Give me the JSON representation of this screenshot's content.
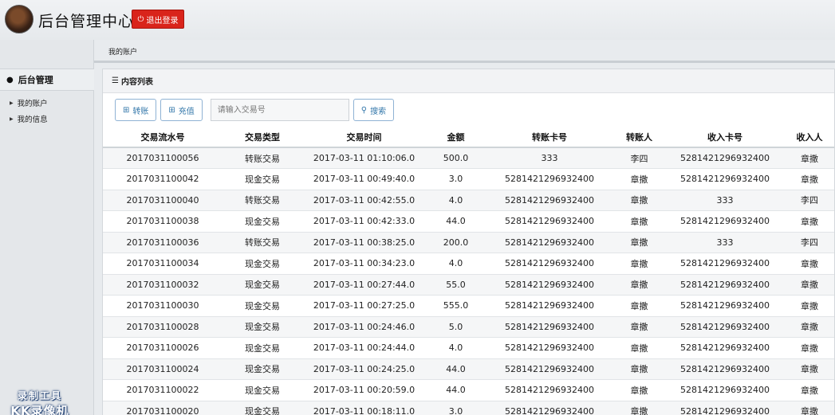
{
  "header": {
    "title": "后台管理中心",
    "logout_label": "退出登录",
    "logout_color": "#d9241b"
  },
  "breadcrumb": "我的账户",
  "sidebar": {
    "section_title": "后台管理",
    "items": [
      {
        "label": "我的账户"
      },
      {
        "label": "我的信息"
      }
    ],
    "watermark_line1": "录制工具",
    "watermark_line2": "KK录像机"
  },
  "panel": {
    "title": "内容列表",
    "transfer_label": "转账",
    "recharge_label": "充值",
    "search_placeholder": "请输入交易号",
    "search_label": "搜索"
  },
  "table": {
    "columns": [
      "交易流水号",
      "交易类型",
      "交易时间",
      "金额",
      "转账卡号",
      "转账人",
      "收入卡号",
      "收入人"
    ],
    "rows": [
      [
        "2017031100056",
        "转账交易",
        "2017-03-11 01:10:06.0",
        "500.0",
        "333",
        "李四",
        "5281421296932400",
        "章撒"
      ],
      [
        "2017031100042",
        "现金交易",
        "2017-03-11 00:49:40.0",
        "3.0",
        "5281421296932400",
        "章撒",
        "5281421296932400",
        "章撒"
      ],
      [
        "2017031100040",
        "转账交易",
        "2017-03-11 00:42:55.0",
        "4.0",
        "5281421296932400",
        "章撒",
        "333",
        "李四"
      ],
      [
        "2017031100038",
        "现金交易",
        "2017-03-11 00:42:33.0",
        "44.0",
        "5281421296932400",
        "章撒",
        "5281421296932400",
        "章撒"
      ],
      [
        "2017031100036",
        "转账交易",
        "2017-03-11 00:38:25.0",
        "200.0",
        "5281421296932400",
        "章撒",
        "333",
        "李四"
      ],
      [
        "2017031100034",
        "现金交易",
        "2017-03-11 00:34:23.0",
        "4.0",
        "5281421296932400",
        "章撒",
        "5281421296932400",
        "章撒"
      ],
      [
        "2017031100032",
        "现金交易",
        "2017-03-11 00:27:44.0",
        "55.0",
        "5281421296932400",
        "章撒",
        "5281421296932400",
        "章撒"
      ],
      [
        "2017031100030",
        "现金交易",
        "2017-03-11 00:27:25.0",
        "555.0",
        "5281421296932400",
        "章撒",
        "5281421296932400",
        "章撒"
      ],
      [
        "2017031100028",
        "现金交易",
        "2017-03-11 00:24:46.0",
        "5.0",
        "5281421296932400",
        "章撒",
        "5281421296932400",
        "章撒"
      ],
      [
        "2017031100026",
        "现金交易",
        "2017-03-11 00:24:44.0",
        "4.0",
        "5281421296932400",
        "章撒",
        "5281421296932400",
        "章撒"
      ],
      [
        "2017031100024",
        "现金交易",
        "2017-03-11 00:24:25.0",
        "44.0",
        "5281421296932400",
        "章撒",
        "5281421296932400",
        "章撒"
      ],
      [
        "2017031100022",
        "现金交易",
        "2017-03-11 00:20:59.0",
        "44.0",
        "5281421296932400",
        "章撒",
        "5281421296932400",
        "章撒"
      ],
      [
        "2017031100020",
        "现金交易",
        "2017-03-11 00:18:11.0",
        "3.0",
        "5281421296932400",
        "章撒",
        "5281421296932400",
        "章撒"
      ]
    ]
  }
}
